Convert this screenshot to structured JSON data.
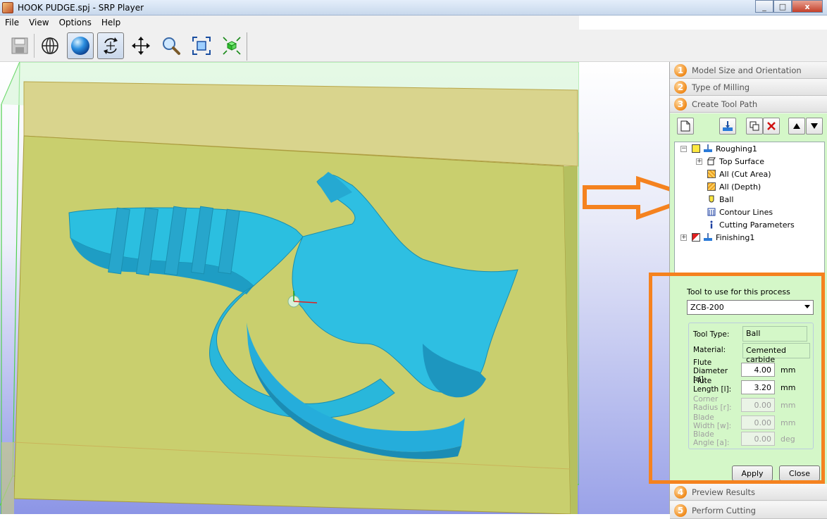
{
  "window": {
    "title": "HOOK PUDGE.spj - SRP Player",
    "buttons": [
      "_",
      "□",
      "x"
    ]
  },
  "menu": [
    "File",
    "View",
    "Options",
    "Help"
  ],
  "toolbar": {
    "items": [
      "save-icon",
      "globe-view-icon",
      "shaded-sphere-icon",
      "rotate-icon",
      "pan-icon",
      "zoom-icon",
      "fit-view-icon",
      "cube-view-icon"
    ],
    "active": "shaded-sphere-icon"
  },
  "steps": [
    {
      "num": "1",
      "label": "Model Size and Orientation"
    },
    {
      "num": "2",
      "label": "Type of Milling"
    },
    {
      "num": "3",
      "label": "Create Tool Path"
    },
    {
      "num": "4",
      "label": "Preview Results"
    },
    {
      "num": "5",
      "label": "Perform Cutting"
    }
  ],
  "panel_tools": [
    "new-page-icon",
    "water-tool-icon",
    "copy-icon",
    "delete-icon",
    "move-up-icon",
    "move-down-icon"
  ],
  "tree": {
    "roughing": "Roughing1",
    "top_surface": "Top Surface",
    "cut_area": "All (Cut Area)",
    "depth": "All (Depth)",
    "ball": "Ball",
    "contour": "Contour Lines",
    "cutting_params": "Cutting Parameters",
    "finishing": "Finishing1"
  },
  "tool": {
    "section_title": "Tool to use for this process",
    "selected": "ZCB-200",
    "tool_type_label": "Tool Type:",
    "tool_type": "Ball",
    "material_label": "Material:",
    "material": "Cemented carbide",
    "flute_diameter_label": "Flute Diameter [d]:",
    "flute_diameter": "4.00",
    "flute_length_label": "Flute Length [l]:",
    "flute_length": "3.20",
    "corner_radius_label": "Corner Radius [r]:",
    "corner_radius": "0.00",
    "blade_width_label": "Blade Width [w]:",
    "blade_width": "0.00",
    "blade_angle_label": "Blade Angle [a]:",
    "blade_angle": "0.00",
    "unit_mm": "mm",
    "unit_deg": "deg",
    "apply": "Apply",
    "close": "Close"
  },
  "colors": {
    "accent_orange": "#f5821f",
    "panel_green": "#d4f7c8",
    "model_cyan": "#27b3d6",
    "stock_yellow": "#c9cf6e"
  }
}
